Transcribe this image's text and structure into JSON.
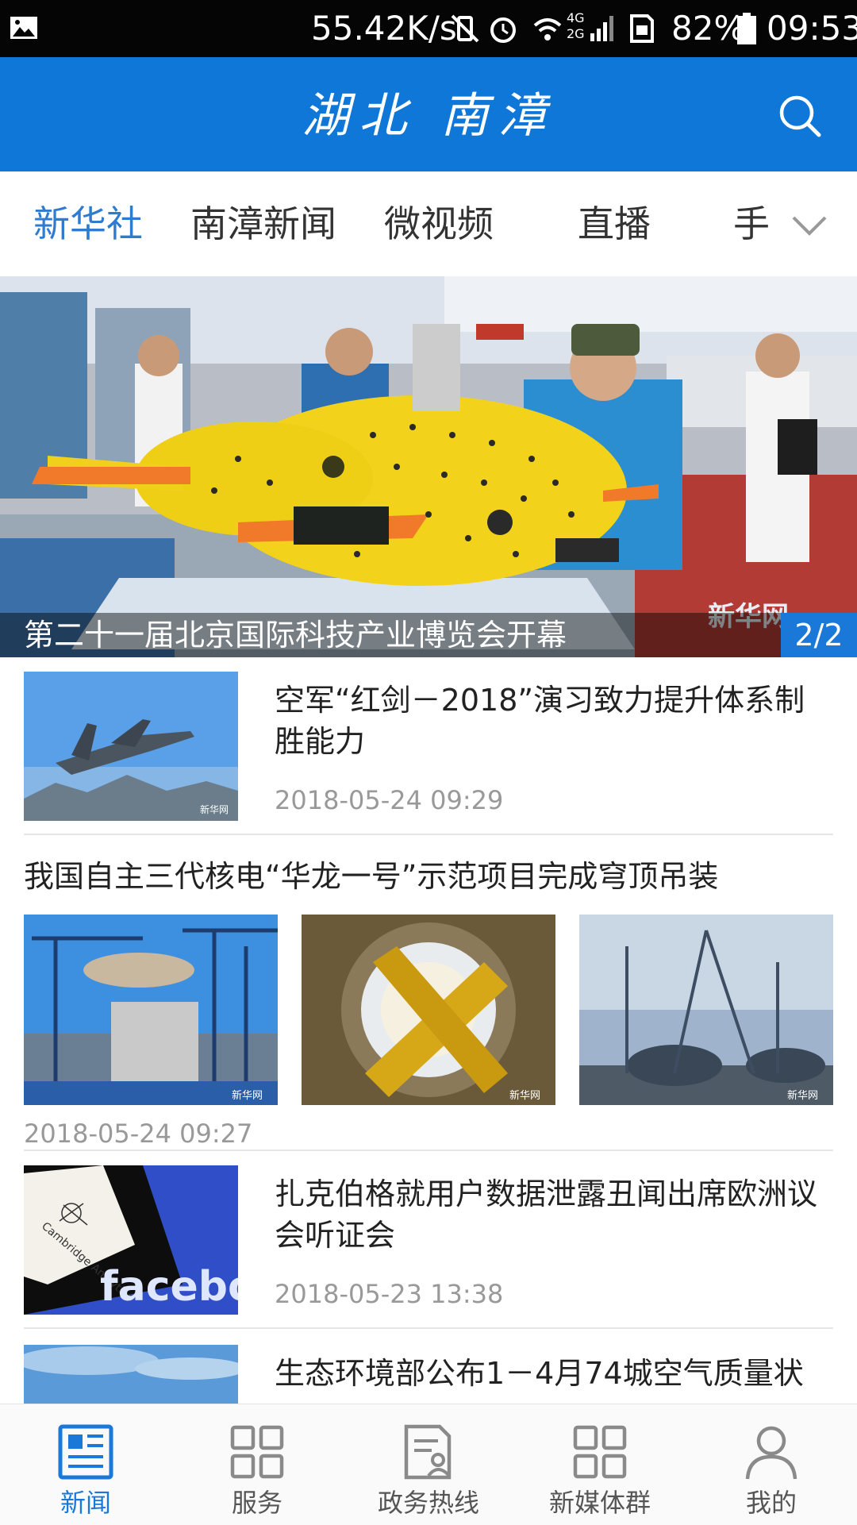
{
  "status_bar": {
    "net_speed": "55.42K/s",
    "signal_badge_top": "4G",
    "signal_badge_bottom": "2G",
    "battery_percent": "82%",
    "time": "09:53"
  },
  "header": {
    "title": "湖北 南漳",
    "search_icon": "search-icon",
    "color": "#0f77d7"
  },
  "tabs": [
    {
      "label": "新华社",
      "active": true
    },
    {
      "label": "南漳新闻",
      "active": false
    },
    {
      "label": "微视频",
      "active": false
    },
    {
      "label": "直播",
      "active": false
    },
    {
      "label": "手",
      "active": false
    }
  ],
  "banner": {
    "caption": "第二十一届北京国际科技产业博览会开幕",
    "counter": "2/2",
    "watermark": "新华网"
  },
  "feed": [
    {
      "title": "空军“红剑－2018”演习致力提升体系制胜能力",
      "date": "2018-05-24 09:29",
      "watermark": "新华网"
    },
    {
      "title": "我国自主三代核电“华龙一号”示范项目完成穹顶吊装",
      "date": "2018-05-24 09:27",
      "watermark": "新华网"
    },
    {
      "title": "扎克伯格就用户数据泄露丑闻出席欧洲议会听证会",
      "date": "2018-05-23 13:38",
      "logo_text": "faceboo",
      "card_text": "Cambridge Analytica"
    },
    {
      "title": "生态环境部公布1－4月74城空气质量状"
    }
  ],
  "bottom_nav": [
    {
      "label": "新闻",
      "icon": "news-icon",
      "active": true
    },
    {
      "label": "服务",
      "icon": "grid-icon",
      "active": false
    },
    {
      "label": "政务热线",
      "icon": "document-user-icon",
      "active": false
    },
    {
      "label": "新媒体群",
      "icon": "grid-icon",
      "active": false
    },
    {
      "label": "我的",
      "icon": "user-icon",
      "active": false
    }
  ],
  "colors": {
    "accent": "#1a78d8",
    "header_bg": "#0f77d7",
    "active_tab": "#2f7bd0",
    "date_text": "#999999"
  }
}
